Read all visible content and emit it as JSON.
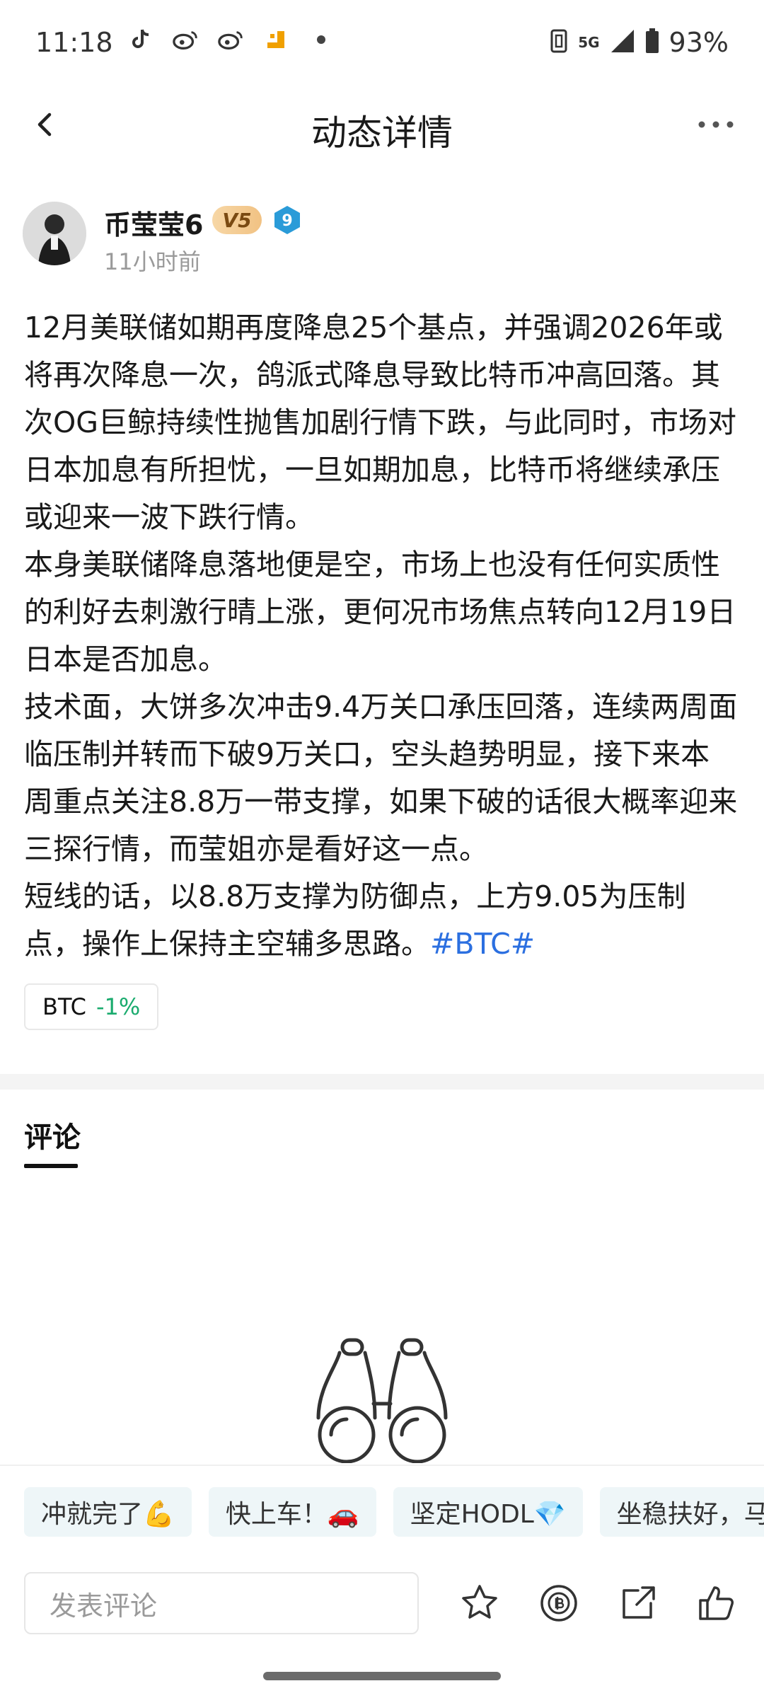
{
  "status_bar": {
    "time": "11:18",
    "network": "5G",
    "battery": "93%",
    "left_icons": [
      "tiktok-icon",
      "weibo-icon",
      "weibo-icon",
      "app-icon",
      "dot-icon"
    ]
  },
  "nav": {
    "title": "动态详情"
  },
  "author": {
    "name": "币莹莹6",
    "vip_badge": "V5",
    "level_badge": "9",
    "time": "11小时前"
  },
  "post": {
    "paragraphs": [
      "12月美联储如期再度降息25个基点，并强调2026年或将再次降息一次，鸽派式降息导致比特币冲高回落。其次OG巨鲸持续性抛售加剧行情下跌，与此同时，市场对日本加息有所担忧，一旦如期加息，比特币将继续承压或迎来一波下跌行情。",
      "本身美联储降息落地便是空，市场上也没有任何实质性的利好去刺激行晴上涨，更何况市场焦点转向12月19日日本是否加息。",
      "技术面，大饼多次冲击9.4万关口承压回落，连续两周面临压制并转而下破9万关口，空头趋势明显，接下来本周重点关注8.8万一带支撑，如果下破的话很大概率迎来三探行情，而莹姐亦是看好这一点。"
    ],
    "last_paragraph": "短线的话，以8.8万支撑为防御点，上方9.05为压制点，操作上保持主空辅多思路。",
    "hashtag": "#BTC#",
    "tag": {
      "symbol": "BTC",
      "change": "-1%"
    }
  },
  "comments": {
    "tab_label": "评论"
  },
  "quick_replies": [
    "冲就完了💪",
    "快上车！🚗",
    "坚定HODL💎",
    "坐稳扶好，马"
  ],
  "bottom": {
    "input_placeholder": "发表评论"
  },
  "colors": {
    "hashtag": "#2b6fe0",
    "negative": "#1aab6e",
    "vip_badge_bg": "#f1c283",
    "level_badge": "#2a9bd8"
  }
}
